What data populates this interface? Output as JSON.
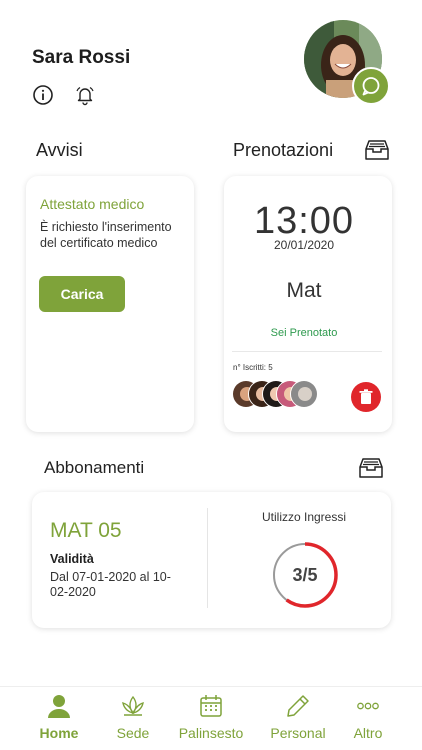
{
  "user": {
    "name": "Sara Rossi"
  },
  "icons": {
    "info": "info-icon",
    "bell": "bell-icon",
    "chat": "chat-icon",
    "inbox": "inbox-tray-icon",
    "trash": "trash-icon"
  },
  "colors": {
    "accent": "#7fa33a",
    "danger": "#e0262b",
    "success": "#2e9a4e"
  },
  "avvisi": {
    "title": "Avvisi",
    "notice_title": "Attestato medico",
    "notice_text": "È richiesto l'inserimento del certificato medico",
    "button_label": "Carica"
  },
  "prenotazioni": {
    "title": "Prenotazioni",
    "time": "13:00",
    "date": "20/01/2020",
    "course": "Mat",
    "status": "Sei Prenotato",
    "iscritti": "n° Iscritti: 5"
  },
  "abbonamenti": {
    "title": "Abbonamenti",
    "name": "MAT 05",
    "validity_label": "Validità",
    "validity_text": "Dal 07-01-2020 al 10-02-2020",
    "usage_label": "Utilizzo Ingressi",
    "usage_text": "3/5",
    "usage_used": 3,
    "usage_total": 5
  },
  "tabs": [
    {
      "label": "Home",
      "icon": "person-icon"
    },
    {
      "label": "Sede",
      "icon": "lotus-icon"
    },
    {
      "label": "Palinsesto",
      "icon": "calendar-icon"
    },
    {
      "label": "Personal",
      "icon": "pencil-icon"
    },
    {
      "label": "Altro",
      "icon": "more-icon"
    }
  ]
}
